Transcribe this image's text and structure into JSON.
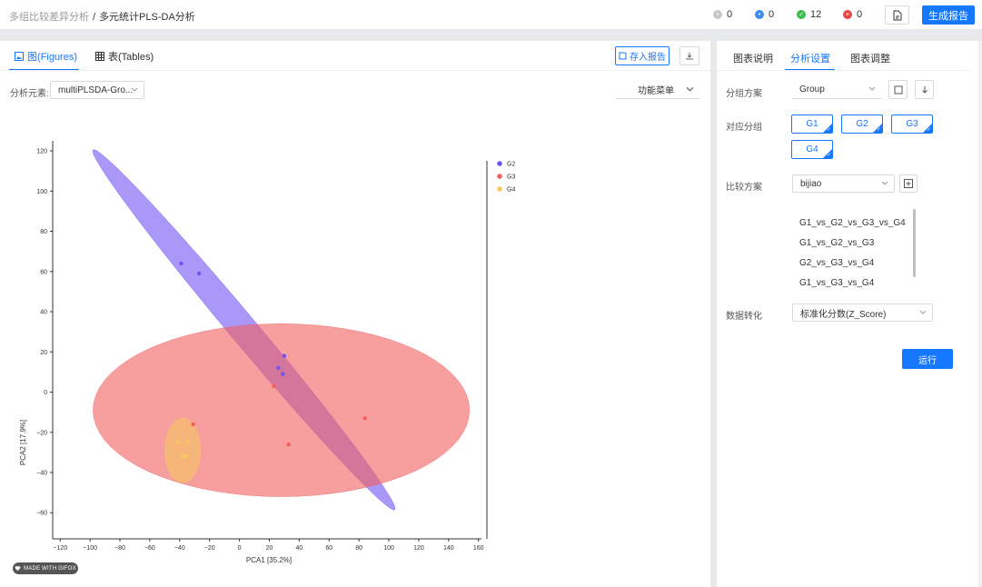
{
  "header": {
    "breadcrumb_parent": "多组比较差异分析",
    "breadcrumb_current": "多元统计PLS-DA分析",
    "stats": [
      {
        "value": "0",
        "color": "#c7c7c7"
      },
      {
        "value": "0",
        "color": "#3d8ef0"
      },
      {
        "value": "12",
        "color": "#3bbd4a"
      },
      {
        "value": "0",
        "color": "#e84646"
      }
    ],
    "report_button": "生成报告"
  },
  "left": {
    "tab_figures": "图(Figures)",
    "tab_tables": "表(Tables)",
    "save_report": "存入报告",
    "analysis_label": "分析元素:",
    "analysis_value": "multiPLSDA-Gro...",
    "right_select": "功能菜单",
    "badge": "MADE WITH GIFOX"
  },
  "chart_data": {
    "type": "scatter",
    "xlabel": "PCA1 [35.2%]",
    "ylabel": "PCA2 [17.9%]",
    "xlim": [
      -125,
      162
    ],
    "ylim": [
      -73,
      125
    ],
    "xticks": [
      -120,
      -100,
      -80,
      -60,
      -40,
      -20,
      0,
      20,
      40,
      60,
      80,
      100,
      120,
      140,
      160
    ],
    "yticks": [
      -60,
      -40,
      -20,
      0,
      20,
      40,
      60,
      80,
      100,
      120
    ],
    "legend_position": "right",
    "series": [
      {
        "name": "G2",
        "color": "#6f54f2",
        "points": [
          [
            -39,
            64
          ],
          [
            -27,
            59
          ],
          [
            30,
            18
          ],
          [
            26,
            12
          ],
          [
            29,
            9
          ]
        ],
        "ellipse": {
          "cx": 3,
          "cy": 31,
          "rx": 135,
          "ry": 8,
          "angle_deg": -41.5
        }
      },
      {
        "name": "G3",
        "color": "#f25f5f",
        "points": [
          [
            -31,
            -16
          ],
          [
            23,
            3
          ],
          [
            33,
            -26
          ],
          [
            84,
            -13
          ]
        ],
        "ellipse": {
          "cx": 28,
          "cy": -9,
          "rx": 126,
          "ry": 43,
          "angle_deg": 0
        }
      },
      {
        "name": "G4",
        "color": "#f7c760",
        "points": [
          [
            -41,
            -25
          ],
          [
            -35,
            -25
          ],
          [
            -38,
            -32
          ],
          [
            -36,
            -32
          ]
        ],
        "ellipse": {
          "cx": -38,
          "cy": -29,
          "rx": 12,
          "ry": 16,
          "angle_deg": 0
        }
      }
    ]
  },
  "right": {
    "tab_desc": "图表说明",
    "tab_settings": "分析设置",
    "tab_adjust": "图表调整",
    "group_label": "分组方案",
    "group_value": "Group",
    "compare_group_label": "对应分组",
    "groups": [
      "G1",
      "G2",
      "G3",
      "G4"
    ],
    "compare_label": "比较方案",
    "compare_value": "bijiao",
    "compare_options": [
      "G1_vs_G2_vs_G3_vs_G4",
      "G1_vs_G2_vs_G3",
      "G2_vs_G3_vs_G4",
      "G1_vs_G3_vs_G4"
    ],
    "transform_label": "数据转化",
    "transform_value": "标准化分数(Z_Score)",
    "run_button": "运行"
  }
}
